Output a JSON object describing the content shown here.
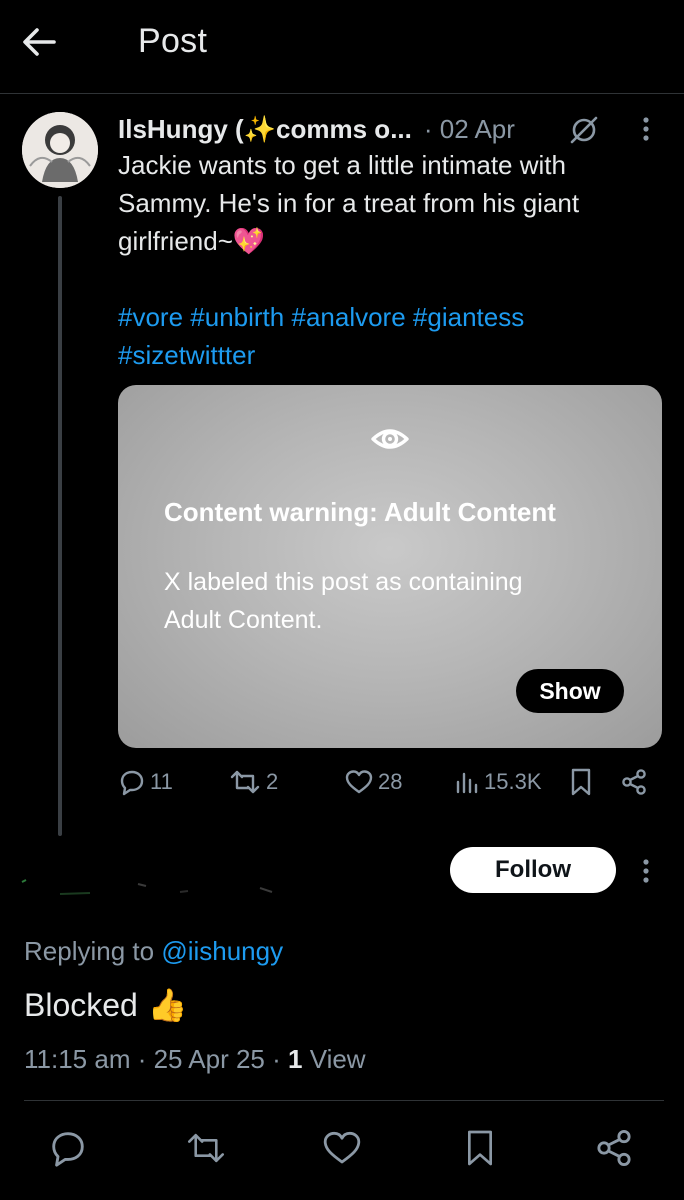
{
  "header": {
    "title": "Post",
    "back_icon": "arrow-left-icon"
  },
  "post": {
    "author_name": "IlsHungy (",
    "author_sparkle": "✨",
    "author_name_rest": "comms o...",
    "date": "· 02 Apr",
    "text_lines": [
      "Jackie wants to get a little intimate with",
      "Sammy. He's in for a treat from his giant",
      "girlfriend~"
    ],
    "text_emoji": "💖",
    "hashtags_line1": [
      "#vore",
      "#unbirth",
      "#analvore",
      "#giantess"
    ],
    "hashtags_line2": [
      "#sizetwittter"
    ],
    "content_warning": {
      "title": "Content warning: Adult Content",
      "body_lines": [
        "X labeled this post as containing",
        "Adult Content."
      ],
      "show_label": "Show"
    },
    "stats": {
      "replies": "11",
      "reposts": "2",
      "likes": "28",
      "views": "15.3K"
    }
  },
  "reply": {
    "follow_label": "Follow",
    "replying_prefix": "Replying to ",
    "replying_mention": "@iishungy",
    "text": "Blocked",
    "emoji": "👍",
    "time": "11:15 am · 25 Apr 25 · ",
    "views_count": "1",
    "views_label": " View"
  },
  "colors": {
    "accent": "#1d9bf0",
    "muted": "#8b98a5",
    "text": "#e7e9ea",
    "background": "#000000"
  }
}
